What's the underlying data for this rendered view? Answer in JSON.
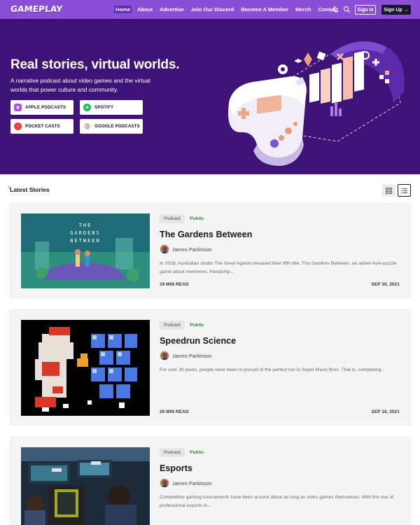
{
  "nav": {
    "logo": "GAMEPLAY",
    "links": [
      "Home",
      "About",
      "Advertise",
      "Join Our Discord",
      "Become A Member",
      "Merch",
      "Contact"
    ],
    "active_index": 0,
    "signin_label": "Sign In",
    "signup_label": "Sign Up",
    "accent": "#8a4fd6"
  },
  "hero": {
    "title": "Real stories, virtual worlds.",
    "subtitle": "A narrative podcast about video games and the virtual worlds that power culture and community.",
    "background": "#3d1378",
    "podcast_buttons": [
      {
        "label": "APPLE PODCASTS",
        "icon": "apple-podcasts-icon",
        "color": "#a855d8"
      },
      {
        "label": "SPOTIFY",
        "icon": "spotify-icon",
        "color": "#1db954"
      },
      {
        "label": "POCKET CASTS",
        "icon": "pocket-casts-icon",
        "color": "#ef3e36"
      },
      {
        "label": "GOOGLE PODCASTS",
        "icon": "google-podcasts-icon",
        "color": "#fbbc04"
      }
    ]
  },
  "latest": {
    "title": "Latest Stories"
  },
  "posts": [
    {
      "tag": "Podcast",
      "visibility": "Public",
      "title": "The Gardens Between",
      "author": "James Parkinson",
      "excerpt": "In 2018, Australian studio The Voxel Agents released their fifth title, The Gardens Between, an adven-ture-puzzle game about memories, friendship...",
      "read_time": "19 MIN READ",
      "date": "SEP 30, 2021",
      "image_text": "THE GARDENS BETWEEN"
    },
    {
      "tag": "Podcast",
      "visibility": "Public",
      "title": "Speedrun Science",
      "author": "James Parkinson",
      "excerpt": "For over 30 years, people have been in pursuit of the perfect run in Super Mario Bros. That is, completing...",
      "read_time": "26 MIN READ",
      "date": "SEP 16, 2021"
    },
    {
      "tag": "Podcast",
      "visibility": "Public",
      "title": "Esports",
      "author": "James Parkinson",
      "excerpt": "Competitive gaming tournaments have been around about as long as video games themselves. With the rise of professional esports in...",
      "read_time": "",
      "date": ""
    }
  ]
}
